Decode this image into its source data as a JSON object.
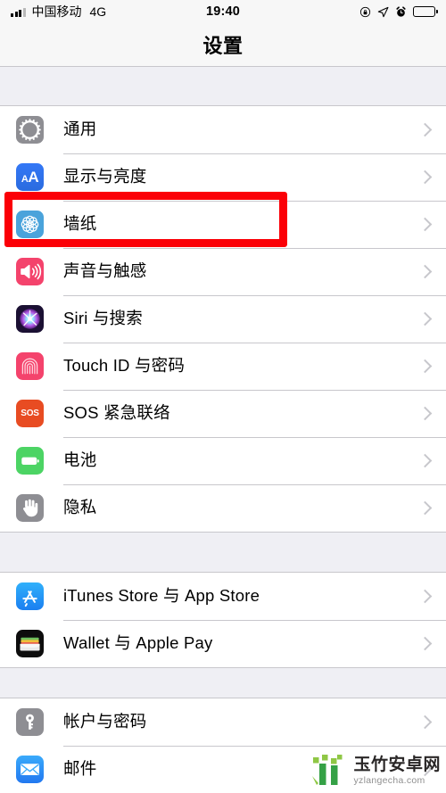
{
  "status_bar": {
    "carrier": "中国移动",
    "network": "4G",
    "time": "19:40",
    "icons": [
      "signal-bars-icon",
      "rotation-lock-icon",
      "location-arrow-icon",
      "alarm-clock-icon",
      "battery-icon"
    ]
  },
  "nav": {
    "title": "设置"
  },
  "groups": [
    {
      "rows": [
        {
          "label": "通用",
          "icon": "gear-icon",
          "icon_key": "general"
        },
        {
          "label": "显示与亮度",
          "icon": "text-size-icon",
          "icon_key": "display"
        },
        {
          "label": "墙纸",
          "icon": "flower-icon",
          "icon_key": "wallpaper"
        },
        {
          "label": "声音与触感",
          "icon": "speaker-icon",
          "icon_key": "sound"
        },
        {
          "label": "Siri 与搜索",
          "icon": "siri-icon",
          "icon_key": "siri"
        },
        {
          "label": "Touch ID 与密码",
          "icon": "fingerprint-icon",
          "icon_key": "touchid"
        },
        {
          "label": "SOS 紧急联络",
          "icon": "sos-icon",
          "icon_key": "sos",
          "icon_text": "SOS"
        },
        {
          "label": "电池",
          "icon": "battery-icon",
          "icon_key": "battery"
        },
        {
          "label": "隐私",
          "icon": "hand-icon",
          "icon_key": "privacy"
        }
      ]
    },
    {
      "rows": [
        {
          "label": "iTunes Store 与 App Store",
          "icon": "app-store-icon",
          "icon_key": "appstore"
        },
        {
          "label": "Wallet 与 Apple Pay",
          "icon": "wallet-icon",
          "icon_key": "wallet"
        }
      ]
    },
    {
      "rows": [
        {
          "label": "帐户与密码",
          "icon": "key-icon",
          "icon_key": "accounts"
        },
        {
          "label": "邮件",
          "icon": "envelope-icon",
          "icon_key": "mail"
        }
      ]
    }
  ],
  "highlight": {
    "target_label": "墙纸",
    "color": "#fb0007"
  },
  "watermark": {
    "name": "玉竹安卓网",
    "url": "yzlangecha.com",
    "logo_color": "#3f9c35"
  },
  "colors": {
    "page_background": "#efeff4",
    "row_background": "#ffffff",
    "separator": "#c8c7cc",
    "chevron": "#c7c7cc",
    "text": "#000000"
  }
}
